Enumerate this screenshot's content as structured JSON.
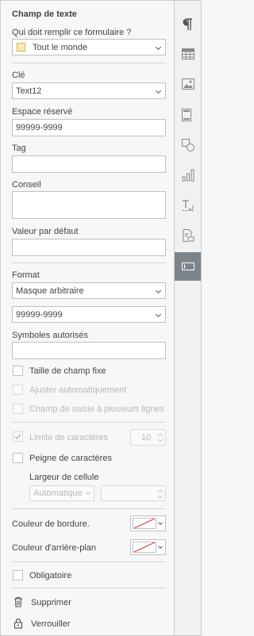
{
  "panel": {
    "title": "Champ de texte",
    "who_label": "Qui doit remplir ce formulaire ?",
    "who_value": "Tout le monde",
    "who_swatch_color": "#fce8a8",
    "key_label": "Clé",
    "key_value": "Text12",
    "placeholder_label": "Espace réservé",
    "placeholder_value": "99999-9999",
    "tag_label": "Tag",
    "tag_value": "",
    "tip_label": "Conseil",
    "tip_value": "",
    "default_label": "Valeur par défaut",
    "default_value": "",
    "format_label": "Format",
    "format_value": "Masque arbitraire",
    "mask_value": "99999-9999",
    "allowed_label": "Symboles autorisés",
    "allowed_value": "",
    "fixed_size_label": "Taille de champ fixe",
    "autofit_label": "Ajuster automatiquement",
    "multiline_label": "Champ de saisie à plusieurs lignes",
    "char_limit_label": "Limite de caractères",
    "char_limit_value": "10",
    "comb_label": "Peigne de caractères",
    "cell_width_label": "Largeur de cellule",
    "cell_width_mode": "Automatique",
    "cell_width_value": "",
    "border_color_label": "Couleur de bordure.",
    "bg_color_label": "Couleur d'arrière-plan",
    "required_label": "Obligatoire",
    "delete_label": "Supprimer",
    "lock_label": "Verrouiller"
  },
  "rightbar": {
    "items": [
      {
        "icon": "paragraph-icon"
      },
      {
        "icon": "table-icon"
      },
      {
        "icon": "image-icon"
      },
      {
        "icon": "header-footer-icon"
      },
      {
        "icon": "shape-icon"
      },
      {
        "icon": "chart-icon"
      },
      {
        "icon": "text-art-icon"
      },
      {
        "icon": "signature-icon"
      },
      {
        "icon": "form-field-icon",
        "active": true
      }
    ]
  },
  "colors": {
    "active_bg": "#7d858c",
    "no_color_line": "#e02020"
  }
}
